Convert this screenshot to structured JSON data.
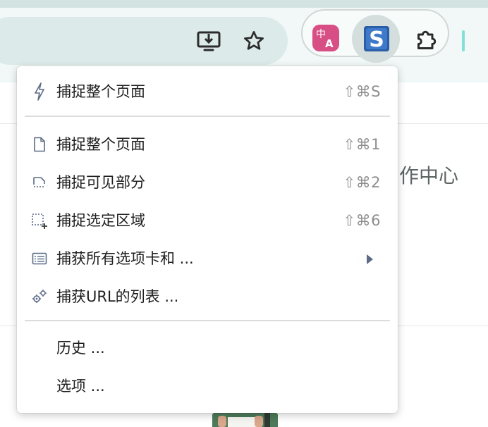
{
  "browser": {
    "install_icon": "install-app-icon",
    "bookmark_icon": "star-icon",
    "extensions": [
      {
        "name": "translate-extension",
        "icon": "translate-icon",
        "glyph_top": "中",
        "glyph_bottom": "A"
      },
      {
        "name": "screenshot-extension",
        "icon": "s-logo-icon",
        "glyph": "S"
      },
      {
        "name": "extensions-menu",
        "icon": "puzzle-icon"
      }
    ]
  },
  "background": {
    "partial_text": "作中心"
  },
  "menu": {
    "items": [
      {
        "label": "捕捉整个页面",
        "shortcut": "⇧⌘S",
        "icon": "lightning-icon"
      },
      {
        "label": "捕捉整个页面",
        "shortcut": "⇧⌘1",
        "icon": "page-icon"
      },
      {
        "label": "捕捉可见部分",
        "shortcut": "⇧⌘2",
        "icon": "visible-area-icon"
      },
      {
        "label": "捕捉选定区域",
        "shortcut": "⇧⌘6",
        "icon": "selection-icon"
      },
      {
        "label": "捕获所有选项卡和 ...",
        "shortcut": "",
        "icon": "tabs-list-icon",
        "has_submenu": true
      },
      {
        "label": "捕获URL的列表 ...",
        "shortcut": "",
        "icon": "gears-icon"
      },
      {
        "label": "历史 ...",
        "shortcut": "",
        "icon": ""
      },
      {
        "label": "选项 ...",
        "shortcut": "",
        "icon": ""
      }
    ]
  },
  "colors": {
    "toolbar_bg": "#f1f8f7",
    "omnibox_bg": "#dcebe9",
    "icon_blue": "#5b6a85",
    "translate_pink": "#d84f86",
    "s_logo_blue": "#2b5ea8"
  }
}
